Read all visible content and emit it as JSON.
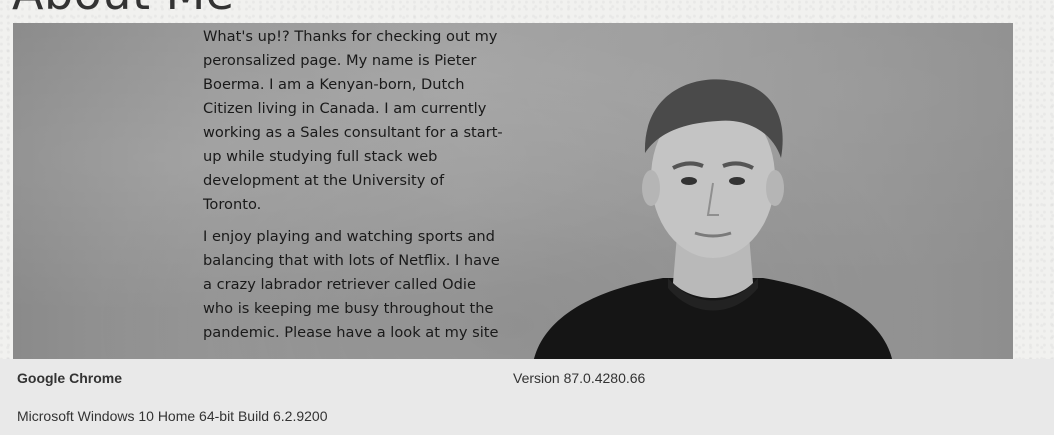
{
  "page": {
    "heading": "About Me"
  },
  "bio": {
    "paragraphs": [
      "What's up!? Thanks for checking out my peronsalized page. My name is Pieter Boerma. I am a Kenyan-born, Dutch Citizen living in Canada. I am currently working as a Sales consultant for a start-up while studying full stack web development at the University of Toronto.",
      "I enjoy playing and watching sports and balancing that with lots of Netflix. I have a crazy labrador retriever called Odie who is keeping me busy throughout the pandemic. Please have a look at my site"
    ]
  },
  "footer": {
    "browser_name": "Google Chrome",
    "browser_version": "Version 87.0.4280.66",
    "os_info": "Microsoft Windows 10 Home 64-bit Build 6.2.9200"
  },
  "colors": {
    "footer_bg": "#e9e9e9",
    "shirt": "#151515"
  }
}
